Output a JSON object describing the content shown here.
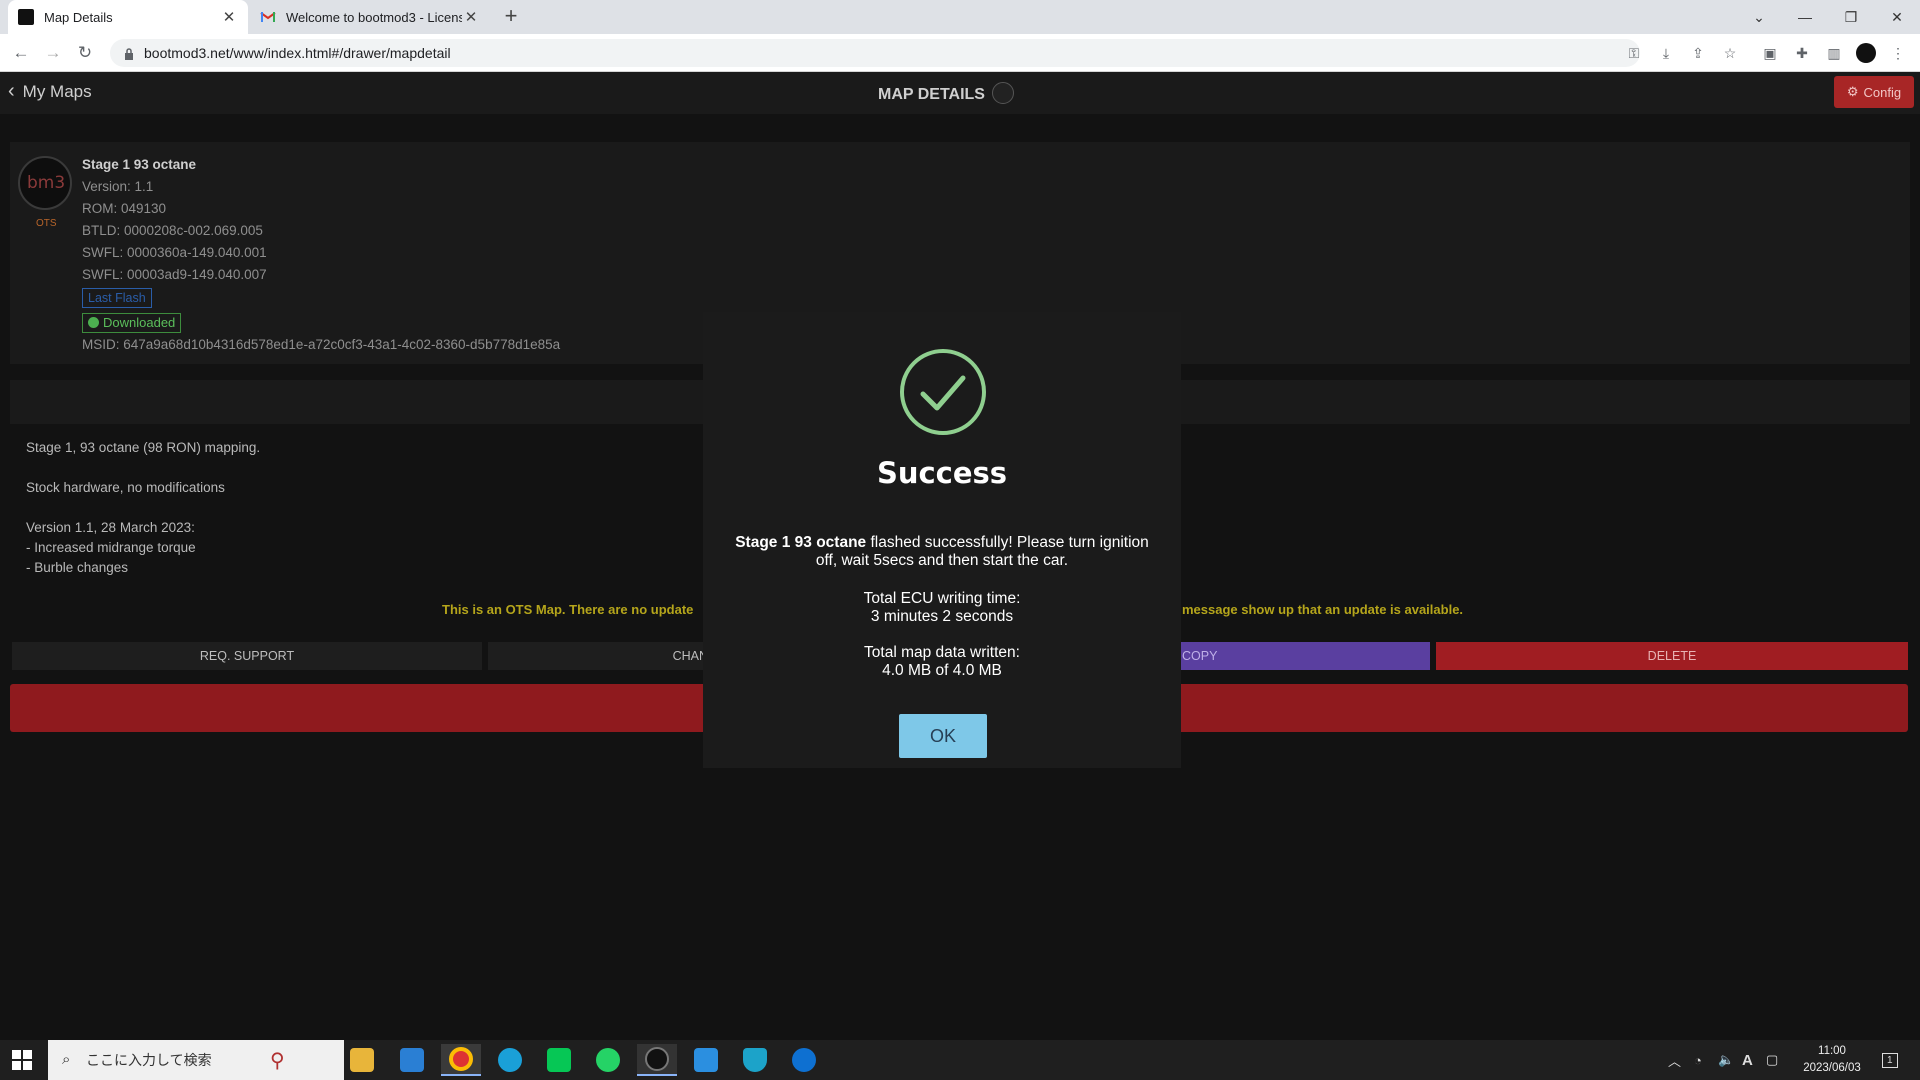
{
  "browser": {
    "tabs": [
      {
        "title": "Map Details",
        "active": true
      },
      {
        "title": "Welcome to bootmod3 - License",
        "active": false
      }
    ],
    "url": "bootmod3.net/www/index.html#/drawer/mapdetail"
  },
  "header": {
    "back_label": "My Maps",
    "title": "MAP DETAILS",
    "config_label": "Config"
  },
  "map": {
    "name": "Stage 1 93 octane",
    "version": "Version: 1.1",
    "rom": "ROM: 049130",
    "btld": "BTLD: 0000208c-002.069.005",
    "swfl1": "SWFL: 0000360a-149.040.001",
    "swfl2": "SWFL: 00003ad9-149.040.007",
    "last_flash_badge": "Last Flash",
    "downloaded_badge": "Downloaded",
    "msid": "MSID: 647a9a68d10b4316d578ed1e-a72c0cf3-43a1-4c02-8360-d5b778d1e85a",
    "ots_label": "OTS"
  },
  "description": {
    "line1": "Stage 1, 93 octane (98 RON) mapping.",
    "line2": "Stock hardware, no modifications",
    "line3": "Version 1.1, 28 March 2023:",
    "line4": "- Increased midrange torque",
    "line5": "- Burble changes"
  },
  "ots_note": {
    "left": "This is an OTS Map. There are no update",
    "right": "message show up that an update is available."
  },
  "actions": {
    "support": "REQ. SUPPORT",
    "change": "CHAN",
    "copy": "COPY",
    "delete": "DELETE"
  },
  "modal": {
    "title": "Success",
    "map_name": "Stage 1 93 octane",
    "message_rest": " flashed successfully! Please turn ignition off, wait 5secs and then start the car.",
    "ecu_time_label": "Total ECU writing time:",
    "ecu_time_value": "3 minutes 2 seconds",
    "data_label": "Total map data written:",
    "data_value": "4.0 MB of 4.0 MB",
    "ok_label": "OK"
  },
  "taskbar": {
    "search_placeholder": "ここに入力して検索",
    "time": "11:00",
    "date": "2023/06/03",
    "ime": "A",
    "notification_count": "1"
  },
  "colors": {
    "success_green": "#8fcf8f",
    "delete_red": "#a01d22",
    "copy_purple": "#5a3fa0",
    "ok_blue": "#7ec8e8"
  }
}
